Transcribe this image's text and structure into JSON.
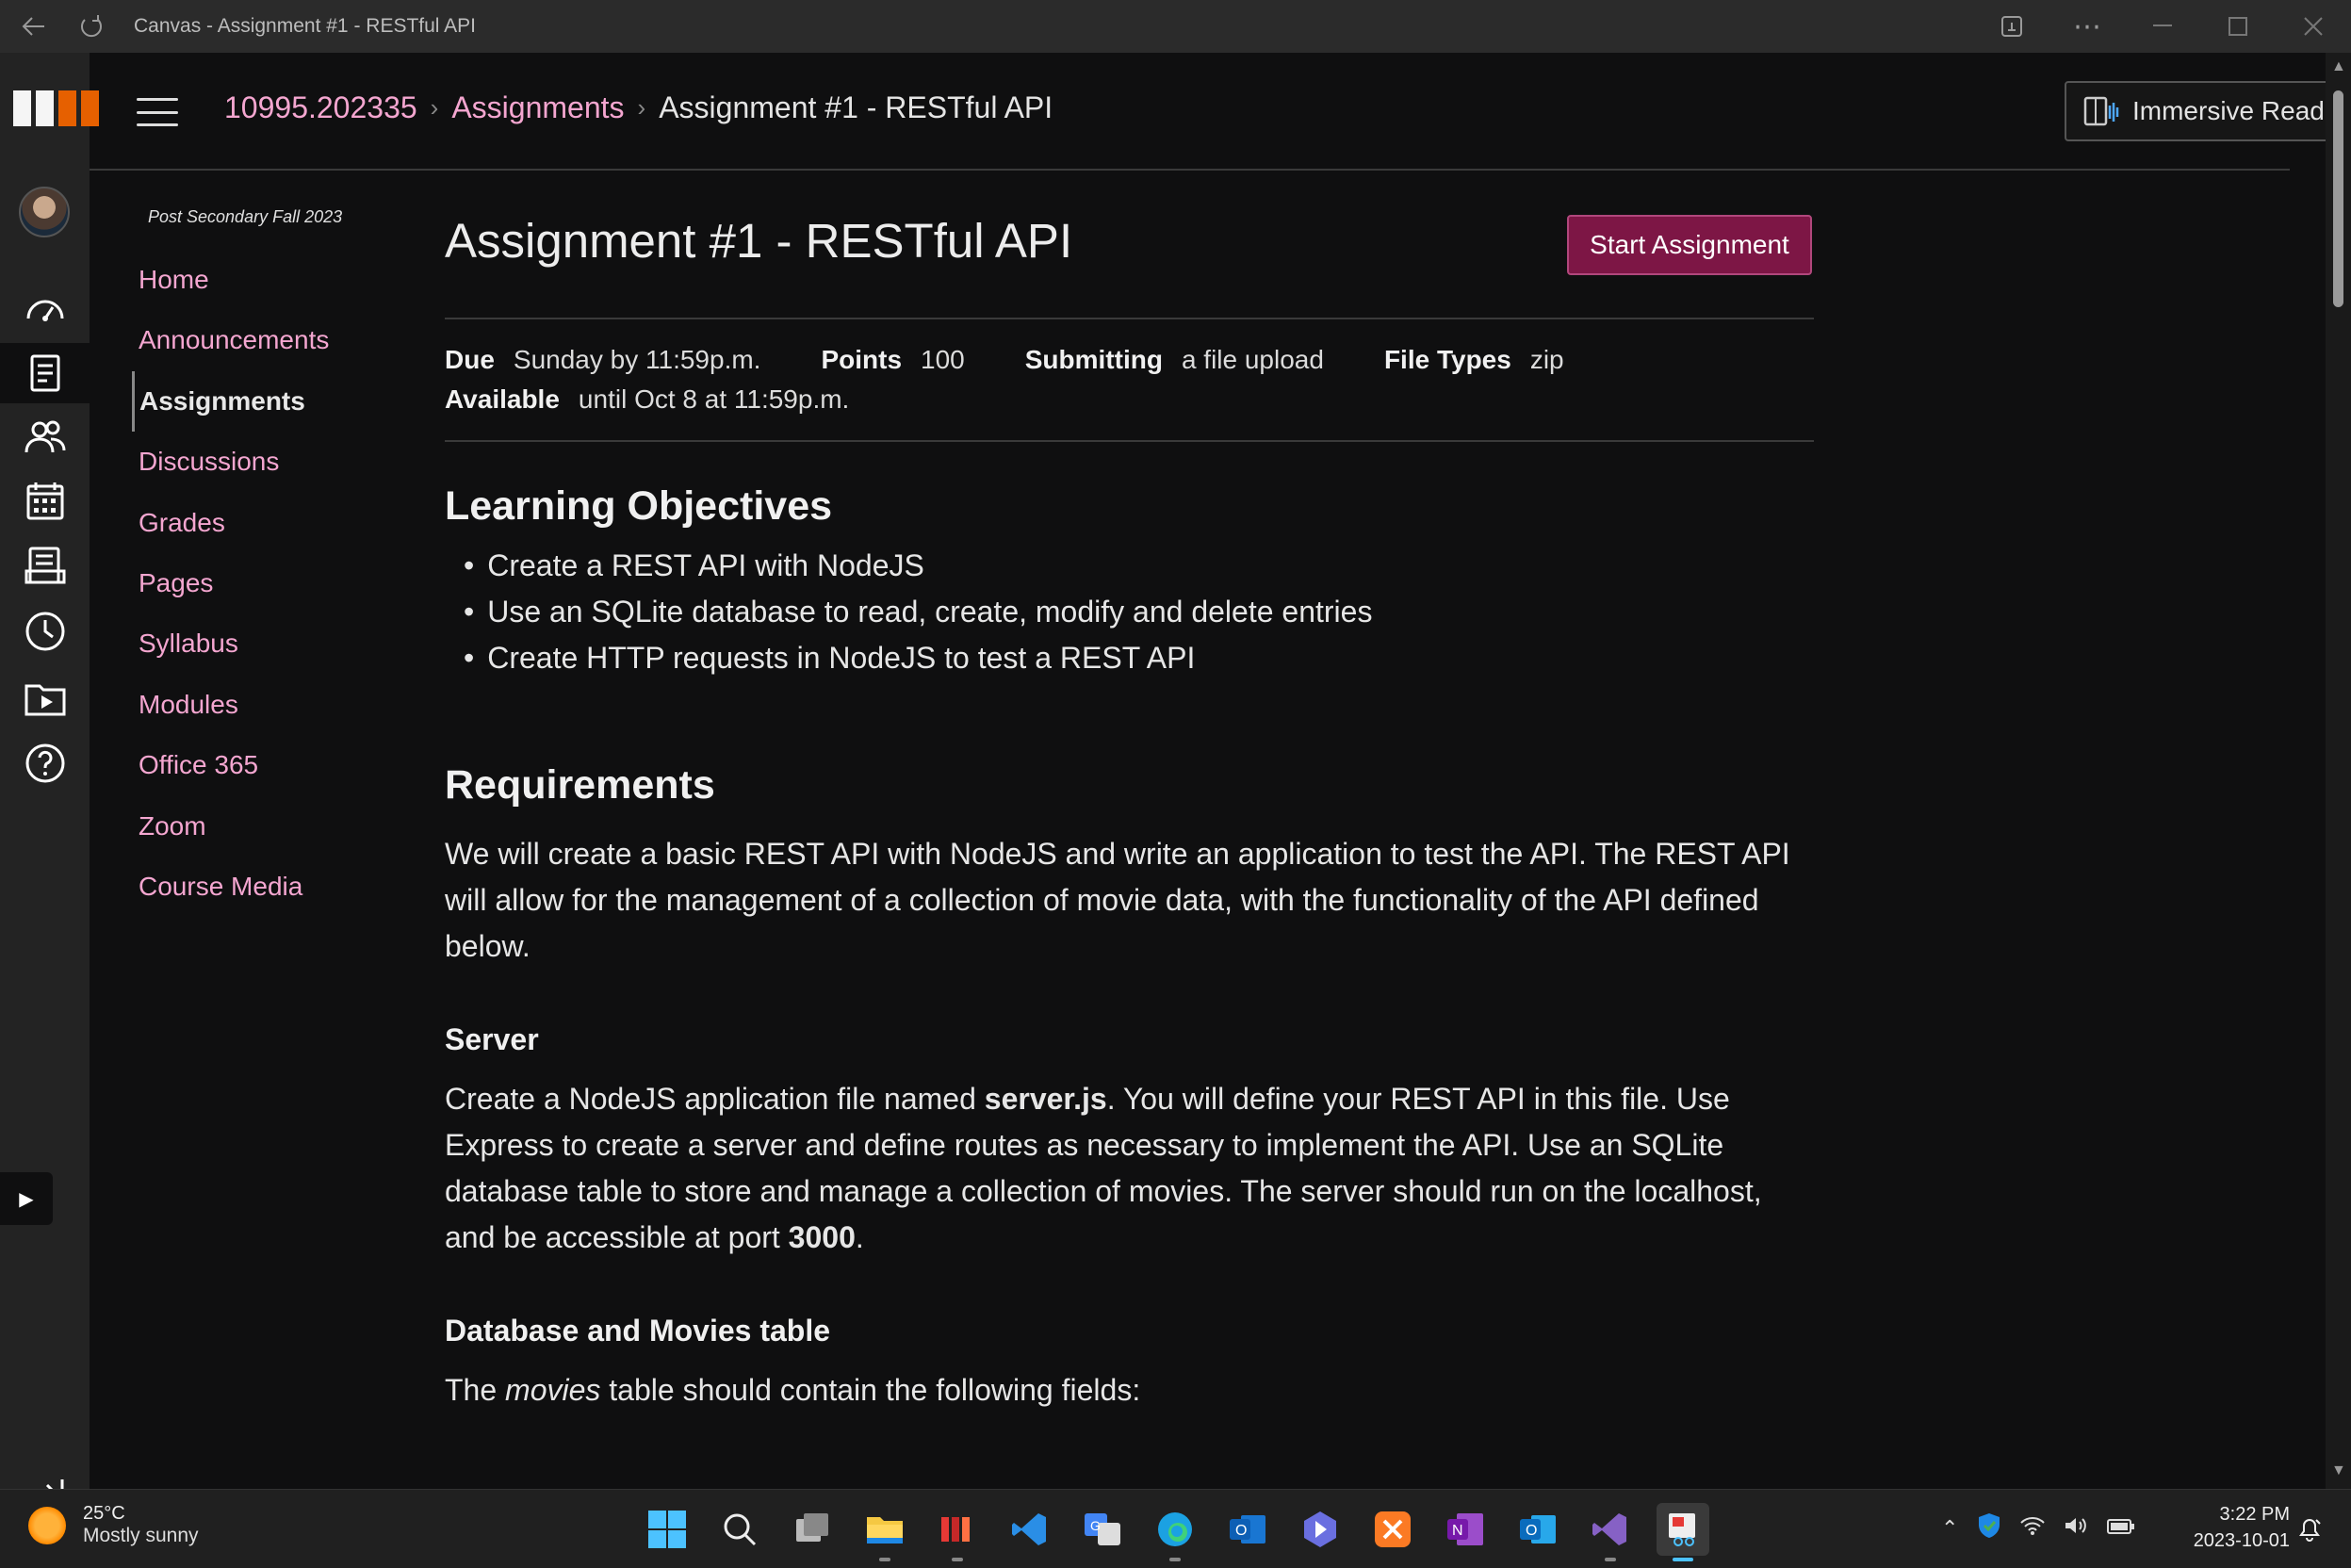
{
  "window": {
    "title": "Canvas - Assignment #1 - RESTful API"
  },
  "breadcrumb": {
    "course": "10995.202335",
    "section": "Assignments",
    "current": "Assignment #1 - RESTful API"
  },
  "header": {
    "immersive_reader_label": "Immersive Reader"
  },
  "course_nav": {
    "term": "Post Secondary Fall 2023",
    "items": [
      {
        "label": "Home"
      },
      {
        "label": "Announcements"
      },
      {
        "label": "Assignments",
        "active": true
      },
      {
        "label": "Discussions"
      },
      {
        "label": "Grades"
      },
      {
        "label": "Pages"
      },
      {
        "label": "Syllabus"
      },
      {
        "label": "Modules"
      },
      {
        "label": "Office 365"
      },
      {
        "label": "Zoom"
      },
      {
        "label": "Course Media"
      }
    ]
  },
  "assignment": {
    "title": "Assignment #1 - RESTful API",
    "start_label": "Start Assignment",
    "due_label": "Due",
    "due_value": "Sunday by 11:59p.m.",
    "points_label": "Points",
    "points_value": "100",
    "submitting_label": "Submitting",
    "submitting_value": "a file upload",
    "filetypes_label": "File Types",
    "filetypes_value": "zip",
    "available_label": "Available",
    "available_value": "until Oct 8 at 11:59p.m."
  },
  "objectives": {
    "heading": "Learning Objectives",
    "items": [
      "Create a REST API with NodeJS",
      "Use an SQLite database to read, create, modify and delete entries",
      "Create HTTP requests in NodeJS to test a REST API"
    ]
  },
  "requirements": {
    "heading": "Requirements",
    "intro": "We will create a basic REST API with NodeJS and write an application to test the API. The REST API will allow for the management of a collection of movie data, with the functionality of the API defined below."
  },
  "server": {
    "heading": "Server",
    "text_1": "Create a NodeJS application file named ",
    "filename": "server.js",
    "text_2": ". You will define your REST API in this file. Use Express to create a server and define routes as necessary to implement the API. Use an SQLite database table to store and manage a collection of movies. The server should run on the localhost, and be accessible at port ",
    "port": "3000",
    "text_3": "."
  },
  "database": {
    "heading": "Database and Movies table",
    "text_1": "The ",
    "table_name": "movies",
    "text_2": " table should contain the following fields:"
  },
  "taskbar": {
    "weather_temp": "25°C",
    "weather_desc": "Mostly sunny",
    "time": "3:22 PM",
    "date": "2023-10-01"
  },
  "colors": {
    "link": "#f4a6d0",
    "primary_button": "#7d1645",
    "background": "#0f0f10"
  }
}
